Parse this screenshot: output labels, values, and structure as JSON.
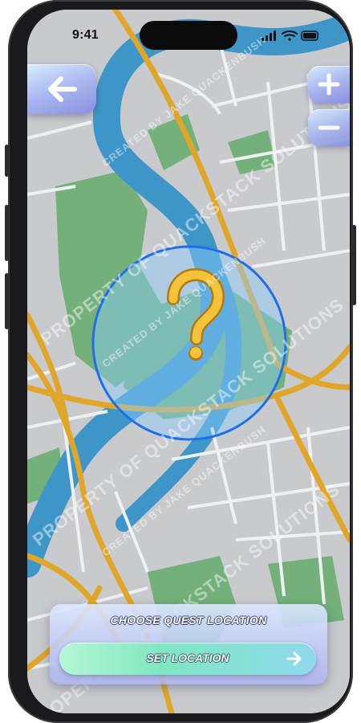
{
  "status_bar": {
    "time": "9:41"
  },
  "map": {
    "colors": {
      "land": "#c8cacd",
      "park": "#74b07a",
      "river": "#3e96c8",
      "major_road": "#e0a62a",
      "minor_road": "#eef0f2"
    },
    "quest_marker": {
      "icon": "question-mark-icon",
      "radius_color": "#1f6fe8"
    }
  },
  "controls": {
    "back": {
      "icon": "arrow-left-icon"
    },
    "zoom_in": {
      "label": "+"
    },
    "zoom_out": {
      "label": "−"
    }
  },
  "watermarks": {
    "owner": "PROPERTY OF QUACKSTACK SOLUTIONS",
    "creator": "CREATED BY JAKE QUACKENBUSH"
  },
  "bottom_panel": {
    "title": "CHOOSE QUEST LOCATION",
    "button_label": "SET LOCATION",
    "button_icon": "arrow-right-icon"
  }
}
